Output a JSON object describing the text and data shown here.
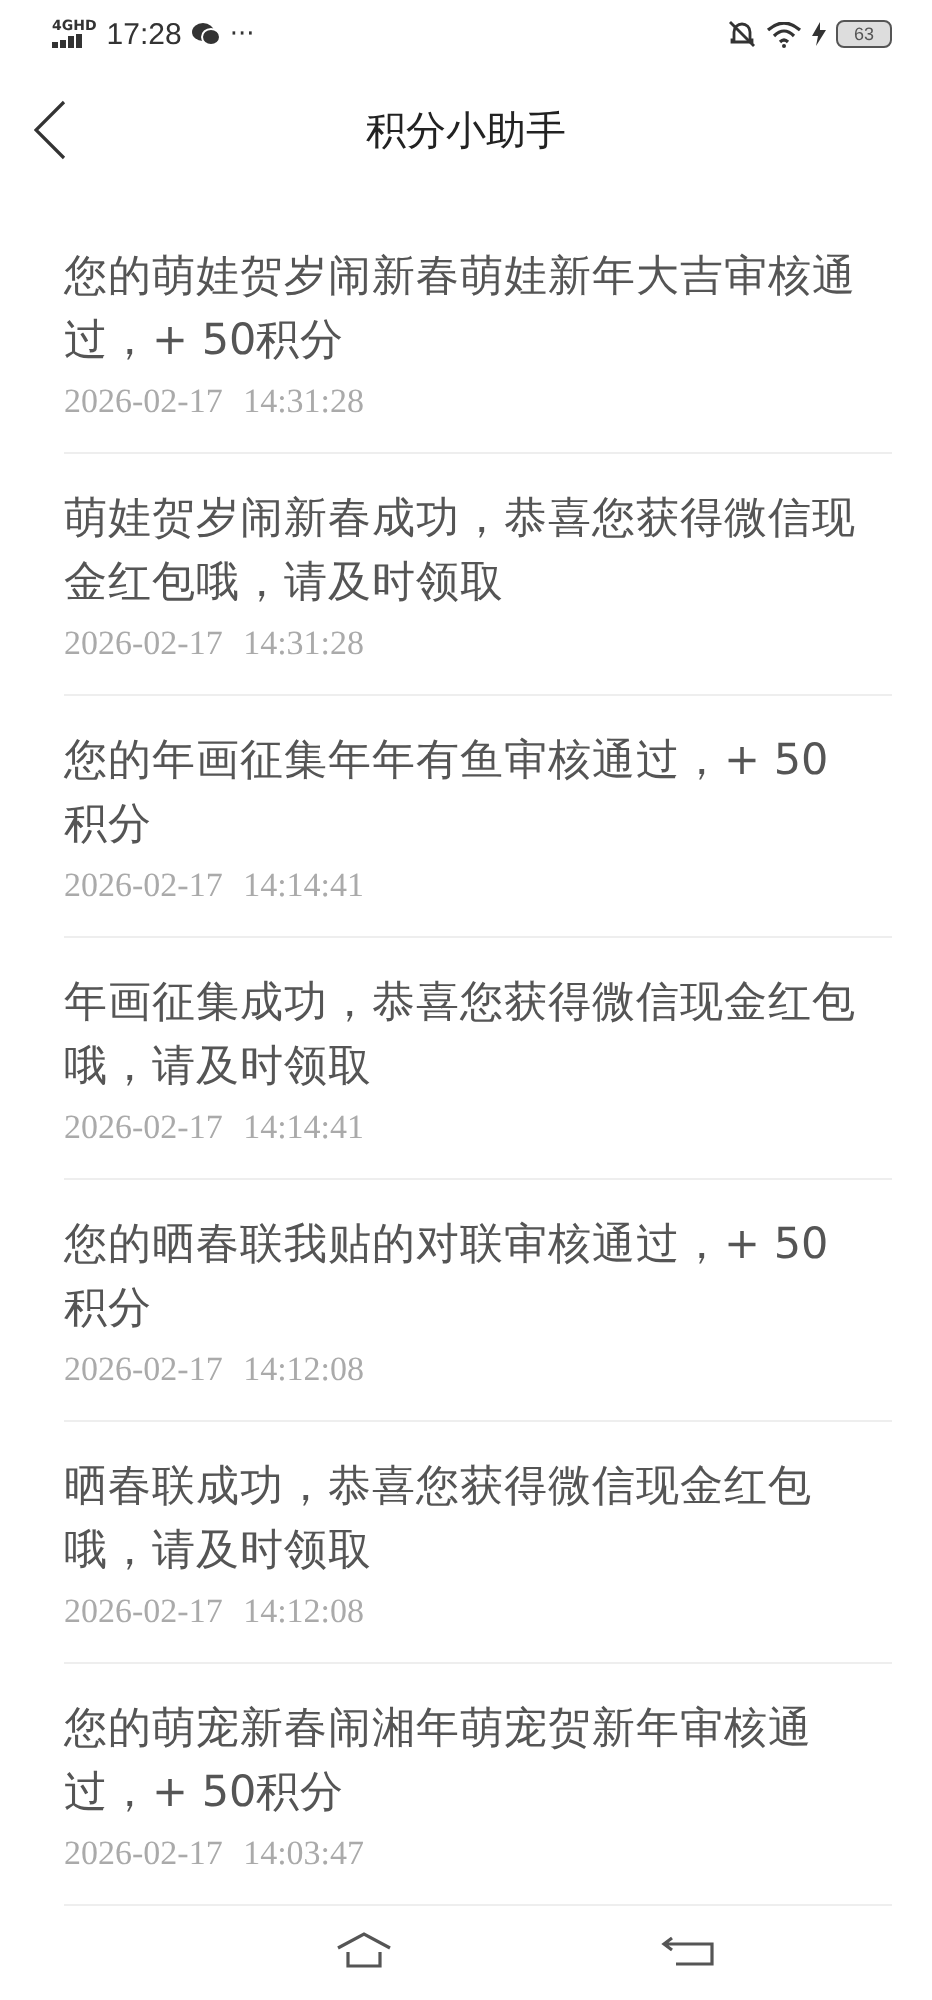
{
  "status_bar": {
    "network": "4G",
    "network_sub": "HD",
    "time": "17:28",
    "more": "···",
    "battery": "63"
  },
  "header": {
    "title": "积分小助手"
  },
  "messages": [
    {
      "text": "您的萌娃贺岁闹新春萌娃新年大吉审核通过，+ 50积分",
      "time": "2026-02-17 14:31:28"
    },
    {
      "text": "萌娃贺岁闹新春成功，恭喜您获得微信现金红包哦，请及时领取",
      "time": "2026-02-17 14:31:28"
    },
    {
      "text": "您的年画征集年年有鱼审核通过，+ 50积分",
      "time": "2026-02-17 14:14:41"
    },
    {
      "text": "年画征集成功，恭喜您获得微信现金红包哦，请及时领取",
      "time": "2026-02-17 14:14:41"
    },
    {
      "text": "您的晒春联我贴的对联审核通过，+ 50积分",
      "time": "2026-02-17 14:12:08"
    },
    {
      "text": "晒春联成功，恭喜您获得微信现金红包哦，请及时领取",
      "time": "2026-02-17 14:12:08"
    },
    {
      "text": "您的萌宠新春闹湘年萌宠贺新年审核通过，+ 50积分",
      "time": "2026-02-17 14:03:47"
    }
  ]
}
